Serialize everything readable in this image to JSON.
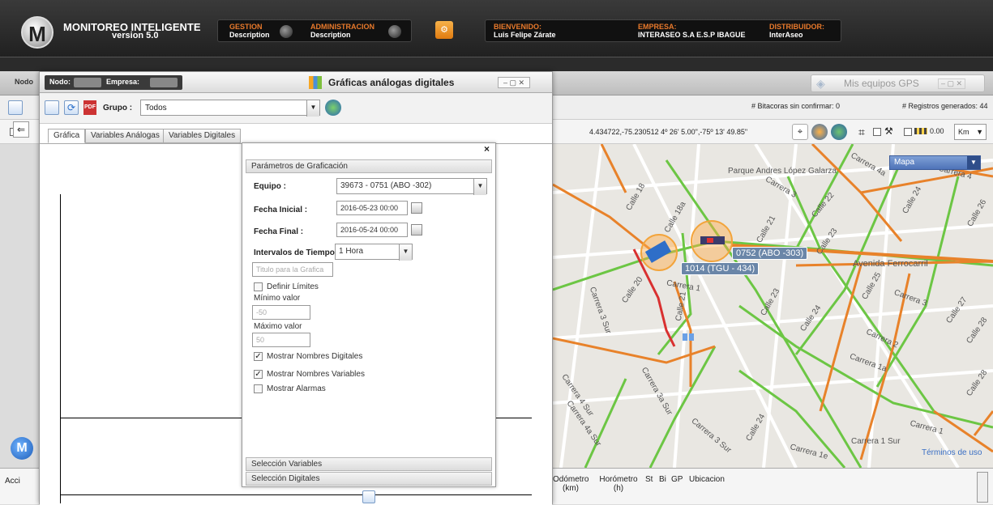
{
  "header": {
    "logo_letter": "M",
    "app_name": "MONITOREO INTELIGENTE",
    "version": "version 5.0",
    "nav": [
      {
        "label": "GESTION",
        "sub": "Description"
      },
      {
        "label": "ADMINISTRACION",
        "sub": "Description"
      }
    ],
    "welcome_label": "BIENVENIDO:",
    "welcome_user": "Luis Felipe Zárate",
    "company_label": "EMPRESA:",
    "company": "INTERASEO S.A E.S.P IBAGUE",
    "distributor_label": "DISTRIBUIDOR:",
    "distributor": "InterAseo"
  },
  "background": {
    "strip_label": "Nodo",
    "gps_window_title": "Mis equipos GPS",
    "bitacoras": "# Bitacoras sin confirmar:  0",
    "registros": "# Registros generados:  44",
    "coords": "4.434722,-75.230512  4º 26' 5.00\",-75º 13' 49.85\"",
    "scale_value": "0.00",
    "unit": "Km"
  },
  "map": {
    "type_selected": "Mapa",
    "terms": "Términos de uso",
    "labels": [
      "Parque Andres López Galarza",
      "Carrera 3",
      "Carrera 4a",
      "Carrera 4",
      "Calle 18",
      "Calle 18a",
      "Calle 21",
      "Calle 22",
      "Calle 24",
      "Calle 26",
      "Calle 23",
      "Avenida Ferrocarril",
      "Carrera 3",
      "Calle 27",
      "Calle 28",
      "Carrera 2",
      "Carrera 1a",
      "Calle 20",
      "Carrera 1",
      "Calle 21",
      "Carrera 3 Sur",
      "Calle 23",
      "Calle 24",
      "Calle 25",
      "Carrera 4 Sur",
      "Carrera 4a Sur",
      "Carrera 3a Sur",
      "Carrera 3 Sur",
      "Calle 24",
      "Carrera 1 Sur",
      "Carrera 1e",
      "Carrera 1",
      "Calle 28"
    ],
    "vehicles": [
      {
        "tag": "0752 (ABO -303)"
      },
      {
        "tag": "1014 (TGU - 434)"
      }
    ]
  },
  "table": {
    "left_label": "Acci",
    "columns": [
      "Odómetro (km)",
      "Horómetro (h)",
      "St",
      "Bi",
      "GP",
      "Ubicacion"
    ]
  },
  "dialog": {
    "filter_nodo": "Nodo:",
    "filter_empresa": "Empresa:",
    "title": "Gráficas análogas digitales",
    "grupo_label": "Grupo :",
    "grupo_value": "Todos",
    "tabs": [
      "Gráfica",
      "Variables Análogas",
      "Variables Digitales"
    ]
  },
  "params": {
    "section_title": "Parámetros de Graficación",
    "equipo_label": "Equipo :",
    "equipo_value": "39673 - 0751 (ABO -302)",
    "fecha_inicial_label": "Fecha Inicial :",
    "fecha_inicial_value": "2016-05-23 00:00",
    "fecha_final_label": "Fecha Final :",
    "fecha_final_value": "2016-05-24 00:00",
    "intervalo_label": "Intervalos de Tiempo :",
    "intervalo_value": "1 Hora",
    "titulo_placeholder": "Titulo para la Grafica",
    "definir_limites": "Definir Límites",
    "minimo_label": "Mínimo valor",
    "minimo_value": "-50",
    "maximo_label": "Máximo valor",
    "maximo_value": "50",
    "mostrar_digitales": "Mostrar Nombres Digitales",
    "mostrar_variables": "Mostrar Nombres Variables",
    "mostrar_alarmas": "Mostrar Alarmas",
    "checked": [
      false,
      true,
      true,
      false
    ],
    "seleccion_variables": "Selección Variables",
    "seleccion_digitales": "Selección Digitales",
    "close": "×"
  }
}
